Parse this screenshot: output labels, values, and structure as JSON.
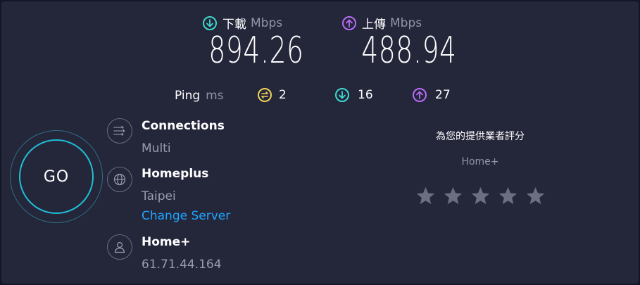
{
  "download": {
    "label": "下載",
    "unit": "Mbps",
    "value": "894.26",
    "icon": "download-arrow-icon",
    "color": "#3fd9d0"
  },
  "upload": {
    "label": "上傳",
    "unit": "Mbps",
    "value": "488.94",
    "icon": "upload-arrow-icon",
    "color": "#b86bf4"
  },
  "ping": {
    "label": "Ping",
    "unit": "ms",
    "idle": {
      "value": "2",
      "icon": "idle-ping-icon",
      "color": "#f2d35a"
    },
    "download": {
      "value": "16",
      "icon": "download-ping-icon",
      "color": "#3fd9d0"
    },
    "upload": {
      "value": "27",
      "icon": "upload-ping-icon",
      "color": "#b86bf4"
    }
  },
  "go_button": {
    "label": "GO",
    "color": "#1fbfd6"
  },
  "connections": {
    "title": "Connections",
    "value": "Multi",
    "icon": "connections-icon"
  },
  "server": {
    "title": "Homeplus",
    "location": "Taipei",
    "change_link": "Change Server",
    "icon": "globe-icon"
  },
  "provider": {
    "title": "Home+",
    "ip": "61.71.44.164",
    "icon": "user-icon"
  },
  "rating": {
    "title": "為您的提供業者評分",
    "provider": "Home+",
    "stars": 5,
    "star_color": "#6c6e82"
  }
}
